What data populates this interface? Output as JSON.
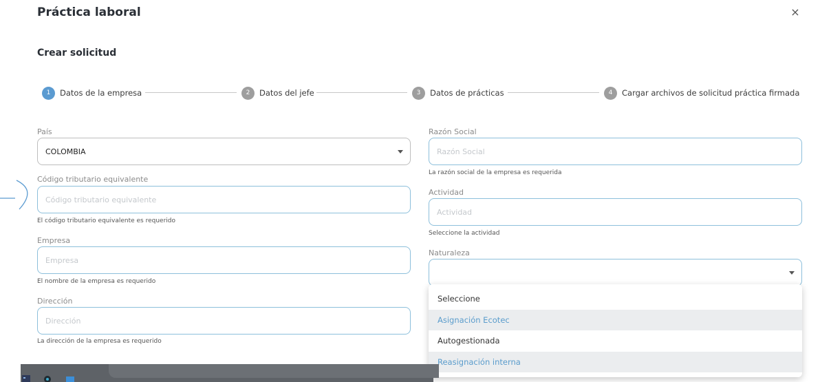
{
  "dialog": {
    "title": "Práctica laboral",
    "close_glyph": "×"
  },
  "section_title": "Crear solicitud",
  "stepper": [
    {
      "num": "1",
      "label": "Datos de la empresa",
      "active": true
    },
    {
      "num": "2",
      "label": "Datos del jefe",
      "active": false
    },
    {
      "num": "3",
      "label": "Datos de prácticas",
      "active": false
    },
    {
      "num": "4",
      "label": "Cargar archivos de solicitud práctica firmada",
      "active": false
    }
  ],
  "form": {
    "pais": {
      "label": "País",
      "value": "COLOMBIA"
    },
    "codigo": {
      "label": "Código tributario equivalente",
      "placeholder": "Código tributario equivalente",
      "help": "El código tributario equivalente es requerido"
    },
    "empresa": {
      "label": "Empresa",
      "placeholder": "Empresa",
      "help": "El nombre de la empresa es requerido"
    },
    "direccion": {
      "label": "Dirección",
      "placeholder": "Dirección",
      "help": "La dirección de la empresa es requerido"
    },
    "razon_social": {
      "label": "Razón Social",
      "placeholder": "Razón Social",
      "help": "La razón social de la empresa es requerida"
    },
    "actividad": {
      "label": "Actividad",
      "placeholder": "Actividad",
      "help": "Seleccione la actividad"
    },
    "naturaleza": {
      "label": "Naturaleza",
      "value": ""
    }
  },
  "naturaleza_options": [
    "Seleccione",
    "Asignación Ecotec",
    "Autogestionada",
    "Reasignación interna"
  ],
  "colors": {
    "accent": "#5b9bd1",
    "input_border": "#8cbfdb",
    "highlight_text": "#5a9ccc"
  },
  "icons": {
    "close": "close-icon",
    "caret": "chevron-down-icon"
  }
}
